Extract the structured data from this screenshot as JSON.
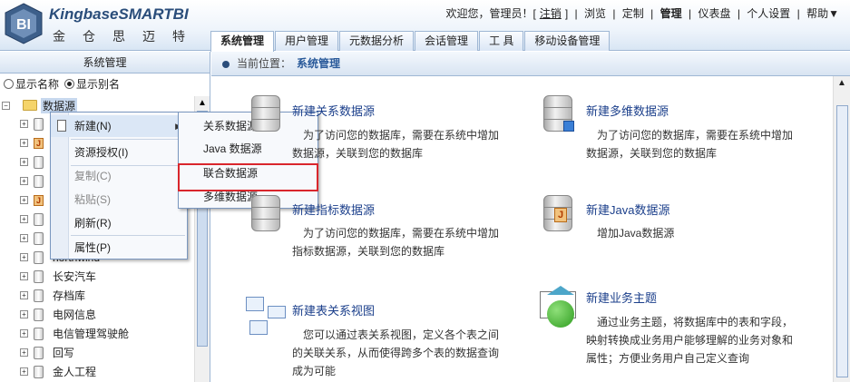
{
  "header": {
    "brand": "Kingbase",
    "brand_product": "SMARTBI",
    "brand_cn": "金仓思迈特",
    "welcome": "欢迎您，管理员！[",
    "logout": "注销",
    "welcome_close": "]",
    "nav": [
      "浏览",
      "定制",
      "管理",
      "仪表盘",
      "个人设置",
      "帮助▼"
    ],
    "active_nav": "管理"
  },
  "tabs": [
    "系统管理",
    "用户管理",
    "元数据分析",
    "会话管理",
    "工 具",
    "移动设备管理"
  ],
  "active_tab": "系统管理",
  "left": {
    "title": "系统管理",
    "radio_name": "显示名称",
    "radio_alias": "显示别名",
    "root_label": "数据源",
    "items": [
      "",
      "",
      "",
      "",
      "",
      "",
      "",
      "northwind",
      "长安汽车",
      "存档库",
      "电网信息",
      "电信管理驾驶舱",
      "回写",
      "金人工程"
    ]
  },
  "context_menu": {
    "items": [
      "新建(N)",
      "资源授权(I)",
      "复制(C)",
      "粘贴(S)",
      "刷新(R)",
      "属性(P)"
    ],
    "submenu": [
      "关系数据源",
      "Java 数据源",
      "联合数据源",
      "多维数据源"
    ]
  },
  "breadcrumb": {
    "label": "当前位置：",
    "current": "系统管理"
  },
  "cards": {
    "rel_title": "新建关系数据源",
    "rel_desc1": "为了访问您的数据库，需要在系统中增加",
    "rel_desc2": "数据源，关联到您的数据库",
    "multi_title": "新建多维数据源",
    "multi_desc1": "为了访问您的数据库，需要在系统中增加",
    "multi_desc2": "数据源，关联到您的数据库",
    "idx_title": "新建指标数据源",
    "idx_desc1": "为了访问您的数据库，需要在系统中增加",
    "idx_desc2": "指标数据源，关联到您的数据库",
    "java_title": "新建Java数据源",
    "java_desc": "增加Java数据源",
    "view_title": "新建表关系视图",
    "view_desc1": "您可以通过表关系视图，定义各个表之间",
    "view_desc2": "的关联关系，从而使得跨多个表的数据查询",
    "view_desc3": "成为可能",
    "topic_title": "新建业务主题",
    "topic_desc1": "通过业务主题，将数据库中的表和字段，",
    "topic_desc2": "映射转换成业务用户能够理解的业务对象和",
    "topic_desc3": "属性；方便业务用户自己定义查询"
  }
}
